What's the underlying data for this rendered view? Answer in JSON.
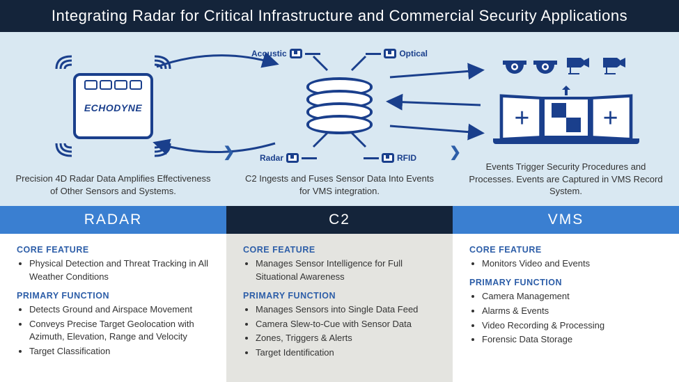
{
  "title": "Integrating Radar for Critical Infrastructure and Commercial Security Applications",
  "radar_brand": "ECHODYNE",
  "sensors": {
    "acoustic": "Acoustic",
    "optical": "Optical",
    "radar": "Radar",
    "rfid": "RFID"
  },
  "captions": {
    "radar": "Precision 4D Radar Data Amplifies Effectiveness of Other Sensors and Systems.",
    "c2": "C2 Ingests and Fuses Sensor Data Into Events for VMS integration.",
    "vms": "Events Trigger Security Procedures and Processes. Events are Captured in VMS Record System."
  },
  "columns": {
    "radar": {
      "header": "RADAR",
      "core_label": "CORE FEATURE",
      "core": [
        "Physical Detection and Threat Tracking in All Weather Conditions"
      ],
      "func_label": "PRIMARY FUNCTION",
      "func": [
        "Detects Ground and Airspace Movement",
        "Conveys Precise Target Geolocation with Azimuth, Elevation, Range and Velocity",
        "Target Classification"
      ]
    },
    "c2": {
      "header": "C2",
      "core_label": "CORE FEATURE",
      "core": [
        "Manages Sensor Intelligence for Full Situational Awareness"
      ],
      "func_label": "PRIMARY FUNCTION",
      "func": [
        "Manages Sensors into Single Data Feed",
        "Camera Slew-to-Cue with Sensor Data",
        "Zones, Triggers & Alerts",
        "Target Identification"
      ]
    },
    "vms": {
      "header": "VMS",
      "core_label": "CORE FEATURE",
      "core": [
        "Monitors Video and Events"
      ],
      "func_label": "PRIMARY FUNCTION",
      "func": [
        "Camera Management",
        "Alarms & Events",
        "Video Recording & Processing",
        "Forensic Data Storage"
      ]
    }
  }
}
